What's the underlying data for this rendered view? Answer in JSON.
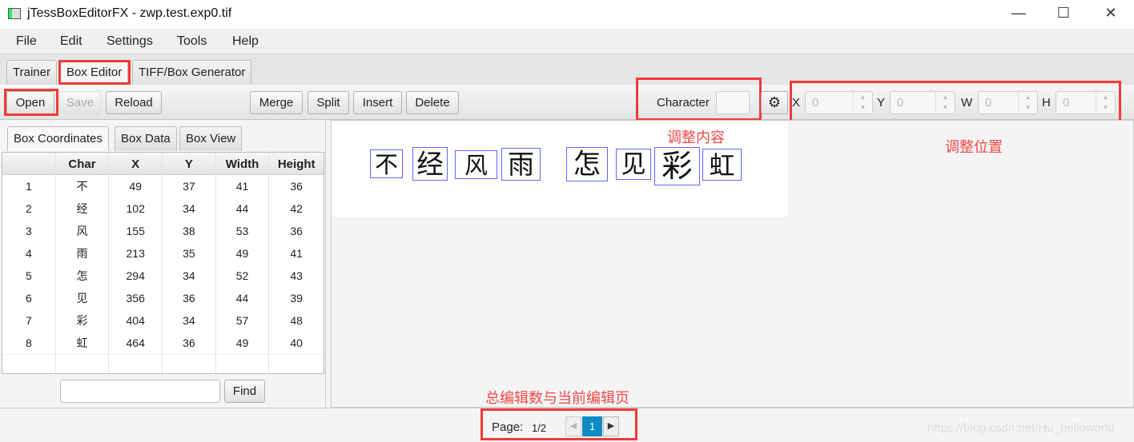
{
  "window": {
    "title": "jTessBoxEditorFX - zwp.test.exp0.tif",
    "minimize": "—",
    "maximize": "☐",
    "close": "✕"
  },
  "menu": [
    "File",
    "Edit",
    "Settings",
    "Tools",
    "Help"
  ],
  "tabs": [
    "Trainer",
    "Box Editor",
    "TIFF/Box Generator"
  ],
  "active_tab": "Box Editor",
  "toolbar": {
    "open": "Open",
    "save": "Save",
    "reload": "Reload",
    "merge": "Merge",
    "split": "Split",
    "insert": "Insert",
    "delete": "Delete",
    "character_label": "Character",
    "character_value": "",
    "settings_icon": "gear-icon",
    "x_label": "X",
    "x_value": "0",
    "y_label": "Y",
    "y_value": "0",
    "w_label": "W",
    "w_value": "0",
    "h_label": "H",
    "h_value": "0"
  },
  "left_tabs": [
    "Box Coordinates",
    "Box Data",
    "Box View"
  ],
  "table": {
    "columns": [
      "",
      "Char",
      "X",
      "Y",
      "Width",
      "Height"
    ],
    "rows": [
      [
        "1",
        "不",
        "49",
        "37",
        "41",
        "36"
      ],
      [
        "2",
        "经",
        "102",
        "34",
        "44",
        "42"
      ],
      [
        "3",
        "风",
        "155",
        "38",
        "53",
        "36"
      ],
      [
        "4",
        "雨",
        "213",
        "35",
        "49",
        "41"
      ],
      [
        "5",
        "怎",
        "294",
        "34",
        "52",
        "43"
      ],
      [
        "6",
        "见",
        "356",
        "36",
        "44",
        "39"
      ],
      [
        "7",
        "彩",
        "404",
        "34",
        "57",
        "48"
      ],
      [
        "8",
        "虹",
        "464",
        "36",
        "49",
        "40"
      ]
    ]
  },
  "find": {
    "value": "",
    "button": "Find"
  },
  "annotations": {
    "content": "调整内容",
    "position": "调整位置",
    "pages": "总编辑数与当前编辑页"
  },
  "pagination": {
    "label": "Page:",
    "value": "1/2",
    "current": "1"
  },
  "watermark": "https://blog.csdn.net/Hu_helloworld",
  "colors": {
    "box_outline": "#6666ff",
    "annotation_red": "#f03a3a",
    "active_page": "#0e8bc4"
  }
}
